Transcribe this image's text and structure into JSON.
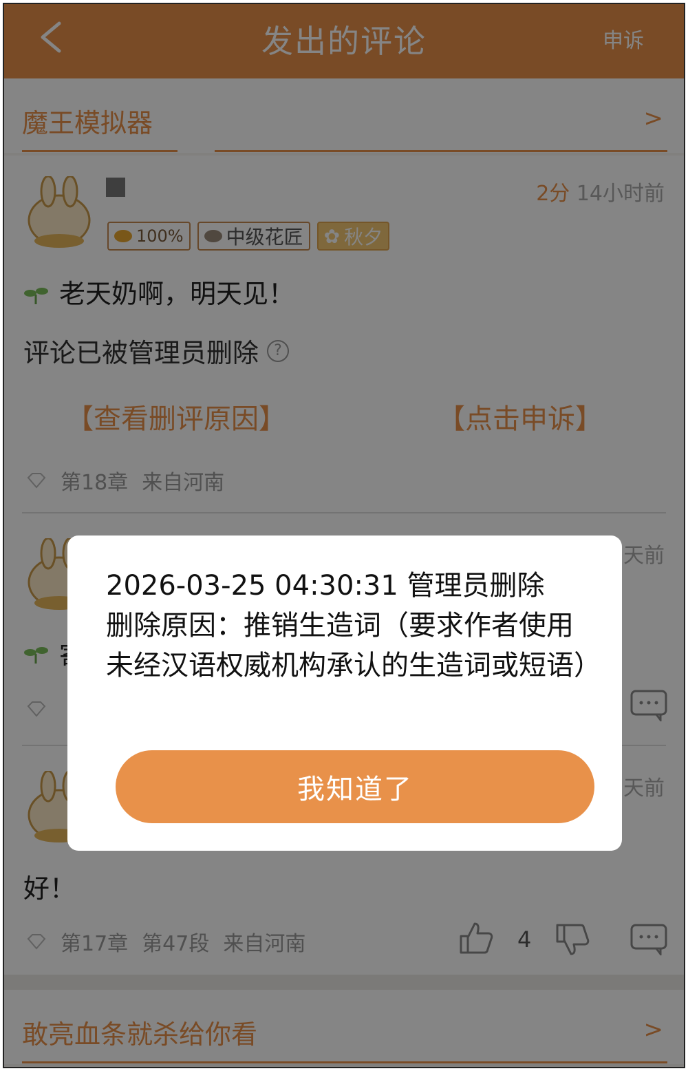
{
  "header": {
    "title": "发出的评论",
    "appeal_label": "申诉"
  },
  "book_top": {
    "name": "魔王模拟器",
    "chevron": ">"
  },
  "comments": [
    {
      "time_num": "2分",
      "time_rest": " 14小时前",
      "badges": {
        "percent": "100%",
        "level": "中级花匠",
        "title": "秋夕"
      },
      "text": "老天奶啊，明天见！",
      "deleted_notice": "评论已被管理员删除",
      "help_icon": "?",
      "view_reason": "【查看删评原因】",
      "appeal": "【点击申诉】",
      "meta": [
        "第18章",
        "来自河南"
      ]
    },
    {
      "time_fragment": "天前",
      "text_fragment": "寄"
    },
    {
      "time_fragment": "天前",
      "text": "好！",
      "meta": [
        "第17章",
        "第47段",
        "来自河南"
      ],
      "likes": "4"
    }
  ],
  "book_bottom": {
    "name": "敢亮血条就杀给你看",
    "chevron": ">"
  },
  "dialog": {
    "line1": "2026-03-25 04:30:31 管理员删除",
    "line2": "删除原因：推销生造词（要求作者使用未经汉语权威机构承认的生造词或短语）",
    "confirm_label": "我知道了"
  },
  "colors": {
    "accent": "#e8914a",
    "overlay": "rgba(0,0,0,0.48)"
  }
}
